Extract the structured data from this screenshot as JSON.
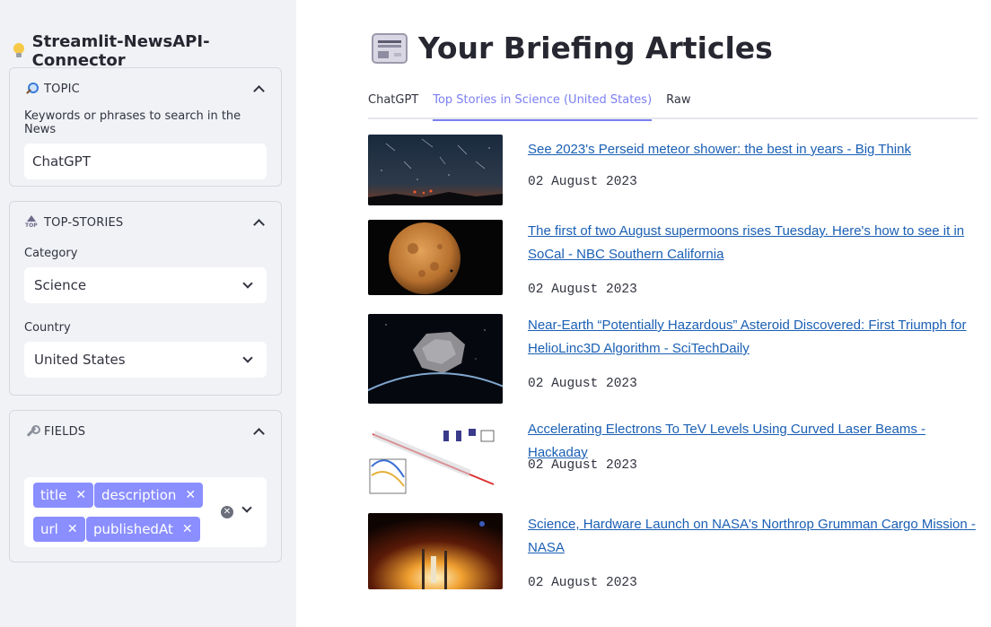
{
  "sidebar": {
    "app_title": "Streamlit-NewsAPI-Connector",
    "topic": {
      "header": "TOPIC",
      "keywords_label": "Keywords or phrases to search in the News",
      "keywords_value": "ChatGPT"
    },
    "top_stories": {
      "header": "TOP-STORIES",
      "category_label": "Category",
      "category_value": "Science",
      "country_label": "Country",
      "country_value": "United States"
    },
    "fields": {
      "header": "FIELDS",
      "tags": [
        "title",
        "description",
        "url",
        "publishedAt"
      ]
    }
  },
  "main": {
    "title": "Your Briefing Articles",
    "tabs": [
      "ChatGPT",
      "Top Stories in Science (United States)",
      "Raw"
    ],
    "active_tab": 1,
    "articles": [
      {
        "title": "See 2023's Perseid meteor shower: the best in years - Big Think",
        "date": "02 August 2023",
        "thumb": "night-sky-meteors"
      },
      {
        "title": "The first of two August supermoons rises Tuesday. Here's how to see it in SoCal - NBC Southern California",
        "date": "02 August 2023",
        "thumb": "supermoon"
      },
      {
        "title": "Near-Earth “Potentially Hazardous” Asteroid Discovered: First Triumph for HelioLinc3D Algorithm - SciTechDaily",
        "date": "02 August 2023",
        "thumb": "asteroid-over-earth"
      },
      {
        "title": "Accelerating Electrons To TeV Levels Using Curved Laser Beams - Hackaday",
        "date": "02 August 2023",
        "thumb": "laser-diagram"
      },
      {
        "title": "Science, Hardware Launch on NASA's Northrop Grumman Cargo Mission - NASA",
        "date": "02 August 2023",
        "thumb": "rocket-launch"
      }
    ]
  },
  "colors": {
    "sidebar_bg": "#f0f2f6",
    "accent": "#7b7ff2",
    "tag_bg": "#8a8eff",
    "link": "#1a5fb4"
  }
}
